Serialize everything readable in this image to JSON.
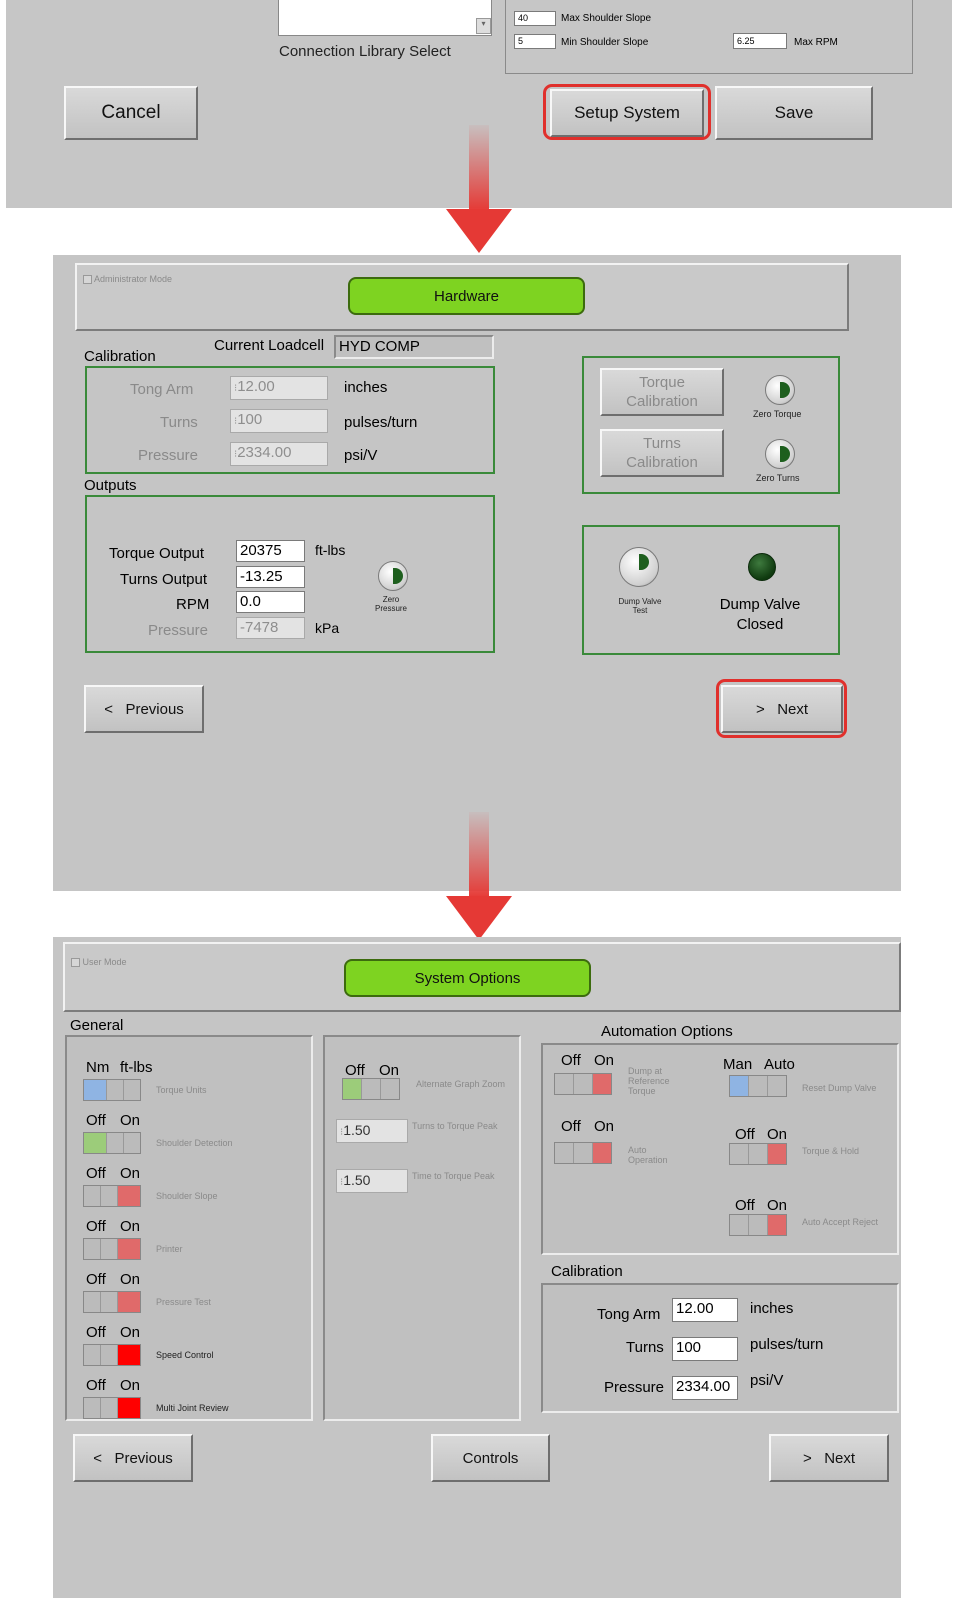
{
  "top": {
    "connection_library_label": "Connection Library Select",
    "max_shoulder_slope_value": "40",
    "max_shoulder_slope_label": "Max Shoulder Slope",
    "min_shoulder_slope_value": "5",
    "min_shoulder_slope_label": "Min Shoulder Slope",
    "max_rpm_value": "6.25",
    "max_rpm_label": "Max RPM",
    "cancel": "Cancel",
    "setup_system": "Setup System",
    "save": "Save"
  },
  "hardware": {
    "admin_mode": "Administrator Mode",
    "title": "Hardware",
    "current_loadcell_label": "Current Loadcell",
    "current_loadcell_value": "HYD COMP",
    "calibration_label": "Calibration",
    "tong_arm_label": "Tong Arm",
    "tong_arm_value": "12.00",
    "tong_arm_unit": "inches",
    "turns_label": "Turns",
    "turns_value": "100",
    "turns_unit": "pulses/turn",
    "pressure_label": "Pressure",
    "pressure_value": "2334.00",
    "pressure_unit": "psi/V",
    "outputs_label": "Outputs",
    "torque_output_label": "Torque Output",
    "torque_output_value": "20375",
    "torque_output_unit": "ft-lbs",
    "turns_output_label": "Turns Output",
    "turns_output_value": "-13.25",
    "rpm_label": "RPM",
    "rpm_value": "0.0",
    "out_pressure_label": "Pressure",
    "out_pressure_value": "-7478",
    "out_pressure_unit": "kPa",
    "zero_pressure_line1": "Zero",
    "zero_pressure_line2": "Pressure",
    "torque_cal_line1": "Torque",
    "torque_cal_line2": "Calibration",
    "turns_cal_line1": "Turns",
    "turns_cal_line2": "Calibration",
    "zero_torque": "Zero Torque",
    "zero_turns": "Zero Turns",
    "dump_valve_test_line1": "Dump Valve",
    "dump_valve_test_line2": "Test",
    "dump_valve_status_line1": "Dump Valve",
    "dump_valve_status_line2": "Closed",
    "previous": "<   Previous",
    "next": ">   Next"
  },
  "options": {
    "user_mode": "User Mode",
    "title": "System Options",
    "general_label": "General",
    "automation_label": "Automation Options",
    "calibration_label": "Calibration",
    "general": [
      {
        "left": "Nm",
        "right": "ft-lbs",
        "label": "Torque Units",
        "state": "left",
        "color": "#8fb4e3"
      },
      {
        "left": "Off",
        "right": "On",
        "label": "Shoulder Detection",
        "state": "left",
        "color": "#9ccc7a"
      },
      {
        "left": "Off",
        "right": "On",
        "label": "Shoulder Slope",
        "state": "right",
        "color": "#e06a6a"
      },
      {
        "left": "Off",
        "right": "On",
        "label": "Printer",
        "state": "right",
        "color": "#e06a6a"
      },
      {
        "left": "Off",
        "right": "On",
        "label": "Pressure Test",
        "state": "right",
        "color": "#e06a6a"
      },
      {
        "left": "Off",
        "right": "On",
        "label": "Speed Control",
        "state": "right",
        "color": "#ff0000"
      },
      {
        "left": "Off",
        "right": "On",
        "label": "Multi Joint Review",
        "state": "right",
        "color": "#ff0000"
      }
    ],
    "alt_graph_off": "Off",
    "alt_graph_on": "On",
    "alt_graph_label": "Alternate Graph Zoom",
    "turns_to_peak_value": "1.50",
    "turns_to_peak_label": "Turns to Torque Peak",
    "time_to_peak_value": "1.50",
    "time_to_peak_label": "Time to Torque Peak",
    "dump_ref_off": "Off",
    "dump_ref_on": "On",
    "dump_ref_label": "Dump at Reference Torque",
    "reset_dump_man": "Man",
    "reset_dump_auto": "Auto",
    "reset_dump_label": "Reset Dump Valve",
    "auto_op_off": "Off",
    "auto_op_on": "On",
    "auto_op_label": "Auto Operation",
    "torque_hold_off": "Off",
    "torque_hold_on": "On",
    "torque_hold_label": "Torque & Hold",
    "auto_accept_off": "Off",
    "auto_accept_on": "On",
    "auto_accept_label": "Auto Accept Reject",
    "cal_tong_label": "Tong Arm",
    "cal_tong_value": "12.00",
    "cal_tong_unit": "inches",
    "cal_turns_label": "Turns",
    "cal_turns_value": "100",
    "cal_turns_unit": "pulses/turn",
    "cal_pressure_label": "Pressure",
    "cal_pressure_value": "2334.00",
    "cal_pressure_unit": "psi/V",
    "previous": "<   Previous",
    "controls": "Controls",
    "next": ">   Next"
  }
}
